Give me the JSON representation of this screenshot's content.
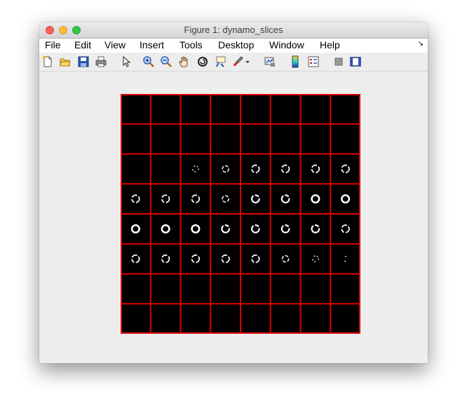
{
  "window": {
    "title": "Figure 1: dynamo_slices"
  },
  "menu": [
    {
      "label": "File"
    },
    {
      "label": "Edit"
    },
    {
      "label": "View"
    },
    {
      "label": "Insert"
    },
    {
      "label": "Tools"
    },
    {
      "label": "Desktop"
    },
    {
      "label": "Window"
    },
    {
      "label": "Help"
    }
  ],
  "toolbar": [
    {
      "icon": "new-figure-icon"
    },
    {
      "icon": "open-file-icon"
    },
    {
      "icon": "save-icon"
    },
    {
      "icon": "print-icon"
    },
    {
      "icon": "pointer-icon"
    },
    {
      "icon": "zoom-in-icon"
    },
    {
      "icon": "zoom-out-icon"
    },
    {
      "icon": "pan-icon"
    },
    {
      "icon": "rotate-3d-icon"
    },
    {
      "icon": "data-cursor-icon"
    },
    {
      "icon": "brush-icon"
    },
    {
      "icon": "link-plot-icon"
    },
    {
      "icon": "colorbar-icon"
    },
    {
      "icon": "legend-icon"
    },
    {
      "icon": "hide-plot-tools-icon"
    },
    {
      "icon": "show-plot-tools-icon"
    }
  ],
  "montage": {
    "rows": 8,
    "cols": 8,
    "background_color": "#000000",
    "grid_color": "#e00000",
    "ring_color": "#ffffff",
    "tiles": [
      [
        "empty",
        "empty",
        "empty",
        "empty",
        "empty",
        "empty",
        "empty",
        "empty"
      ],
      [
        "empty",
        "empty",
        "empty",
        "empty",
        "empty",
        "empty",
        "empty",
        "empty"
      ],
      [
        "empty",
        "empty",
        "faint",
        "sparse",
        "dotted",
        "dotted",
        "dotted",
        "dotted"
      ],
      [
        "dotted",
        "dotted",
        "dotted",
        "sparse",
        "partial",
        "partial",
        "solid",
        "solid"
      ],
      [
        "solid",
        "solid",
        "solid",
        "partial",
        "partial",
        "partial",
        "partial",
        "dotted"
      ],
      [
        "dotted",
        "dotted",
        "dotted",
        "dotted",
        "dotted",
        "sparse",
        "faint",
        "specks"
      ],
      [
        "empty",
        "empty",
        "empty",
        "empty",
        "empty",
        "empty",
        "empty",
        "empty"
      ],
      [
        "empty",
        "empty",
        "empty",
        "empty",
        "empty",
        "empty",
        "empty",
        "empty"
      ]
    ]
  }
}
